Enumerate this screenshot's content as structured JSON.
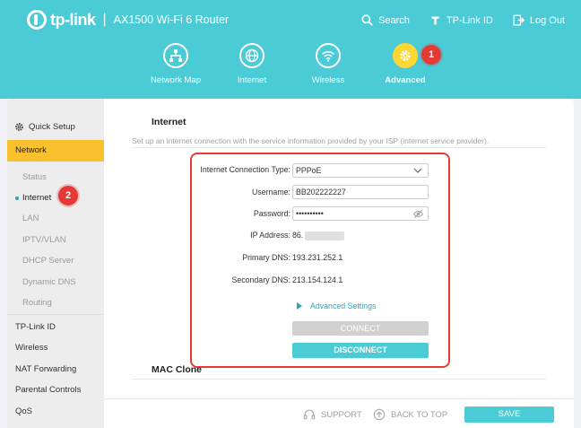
{
  "header": {
    "brand": "tp-link",
    "model": "AX1500 Wi-Fi 6 Router",
    "separator": "|",
    "links": [
      {
        "label": "Search",
        "icon": "search-icon"
      },
      {
        "label": "TP-Link ID",
        "icon": "tplink-id-icon"
      },
      {
        "label": "Log Out",
        "icon": "logout-icon"
      }
    ],
    "nav": [
      {
        "label": "Network Map",
        "icon": "network-map-icon",
        "active": false
      },
      {
        "label": "Internet",
        "icon": "globe-icon",
        "active": false
      },
      {
        "label": "Wireless",
        "icon": "wifi-icon",
        "active": false
      },
      {
        "label": "Advanced",
        "icon": "gear-icon",
        "active": true
      }
    ],
    "badge_1": "1"
  },
  "sidebar": {
    "quick_setup": "Quick Setup",
    "network": "Network",
    "network_sub": [
      "Status",
      "Internet",
      "LAN",
      "IPTV/VLAN",
      "DHCP Server",
      "Dynamic DNS",
      "Routing"
    ],
    "active_sub": "Internet",
    "badge_2": "2",
    "main_items": [
      "TP-Link ID",
      "Wireless",
      "NAT Forwarding",
      "Parental Controls",
      "QoS"
    ]
  },
  "content": {
    "title": "Internet",
    "description": "Set up an internet connection with the service information provided by your ISP (internet service provider).",
    "form": {
      "connection_type_label": "Internet Connection Type:",
      "connection_type_value": "PPPoE",
      "username_label": "Username:",
      "username_value": "BB202222227",
      "password_label": "Password:",
      "password_value": "••••••••••",
      "ip_label": "IP Address:",
      "ip_value": "86.",
      "primary_dns_label": "Primary DNS:",
      "primary_dns_value": "193.231.252.1",
      "secondary_dns_label": "Secondary DNS:",
      "secondary_dns_value": "213.154.124.1",
      "advanced_settings": "Advanced Settings",
      "connect": "CONNECT",
      "disconnect": "DISCONNECT"
    },
    "section2_title": "MAC Clone"
  },
  "footer": {
    "support": "SUPPORT",
    "back_to_top": "BACK TO TOP",
    "save": "SAVE"
  },
  "colors": {
    "header_bg": "#4acbd6",
    "accent_yellow": "#fbc02d",
    "highlight_red": "#e53935",
    "link_teal": "#27a6b4"
  }
}
